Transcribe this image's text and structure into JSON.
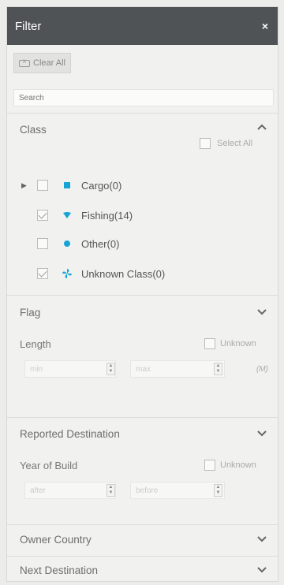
{
  "header": {
    "title": "Filter",
    "close": "×"
  },
  "toolbar": {
    "clear_all": "Clear All"
  },
  "search": {
    "placeholder": "Search"
  },
  "class_section": {
    "title": "Class",
    "select_all": "Select All",
    "items": [
      {
        "label": "Cargo(0)",
        "checked": false,
        "expandable": true,
        "icon": "square-icon",
        "color": "#16a4d6"
      },
      {
        "label": "Fishing(14)",
        "checked": true,
        "expandable": false,
        "icon": "fishing-icon",
        "color": "#16a4d6"
      },
      {
        "label": "Other(0)",
        "checked": false,
        "expandable": false,
        "icon": "circle-icon",
        "color": "#16a4d6"
      },
      {
        "label": "Unknown Class(0)",
        "checked": true,
        "expandable": false,
        "icon": "pinwheel-icon",
        "color": "#16a4d6"
      }
    ]
  },
  "flag_section": {
    "title": "Flag"
  },
  "length_section": {
    "title": "Length",
    "unknown": "Unknown",
    "min_placeholder": "min",
    "max_placeholder": "max",
    "unit": "(M)"
  },
  "reported_destination": {
    "title": "Reported Destination"
  },
  "year_of_build": {
    "title": "Year of Build",
    "unknown": "Unknown",
    "after_placeholder": "after",
    "before_placeholder": "before"
  },
  "owner_country": {
    "title": "Owner Country"
  },
  "next_destination": {
    "title": "Next Destination"
  },
  "colors": {
    "header": "#4f5356",
    "accent": "#16a4d6",
    "panel": "#f1f1ef"
  }
}
